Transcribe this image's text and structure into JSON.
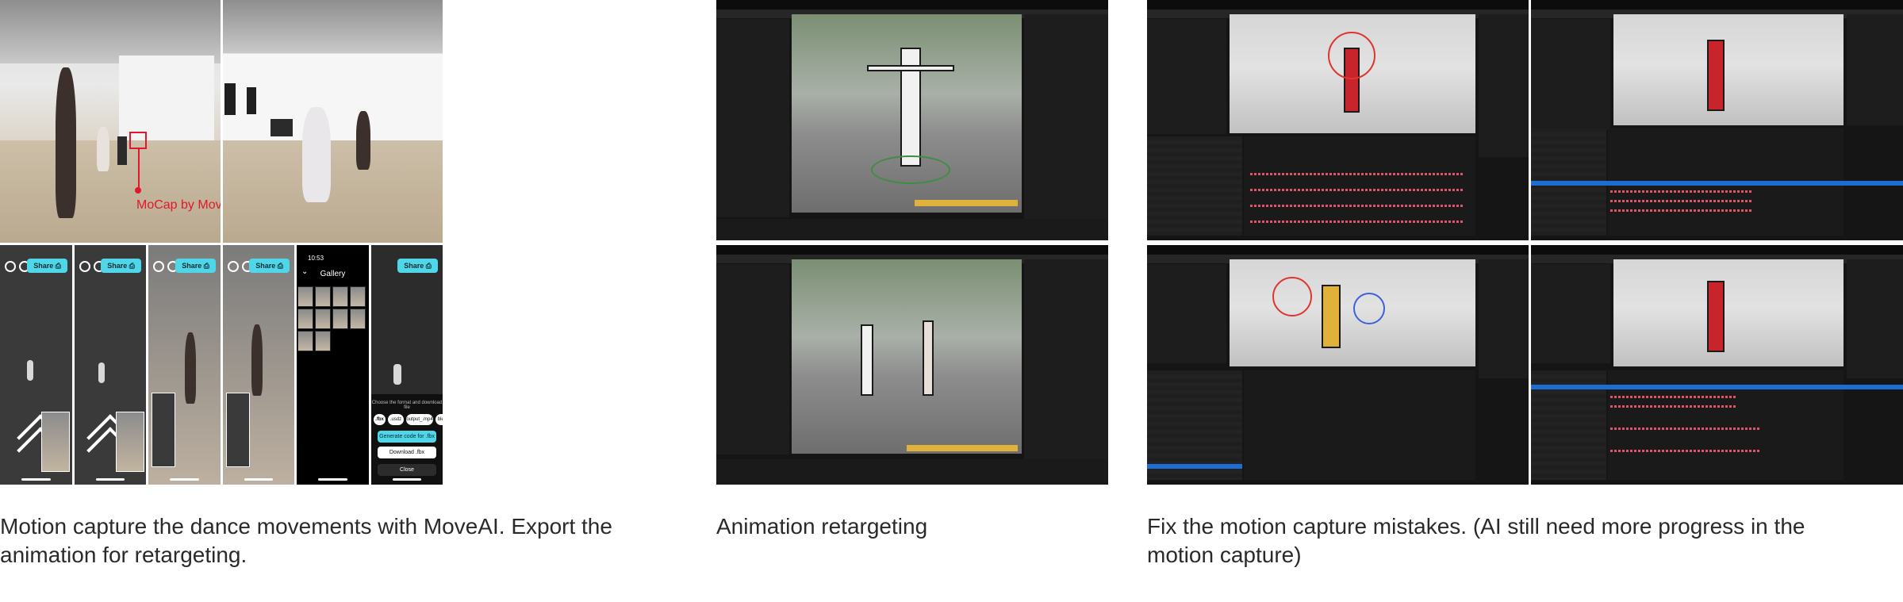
{
  "sections": [
    {
      "caption": "Motion capture the dance movements with MoveAI. Export the animation for retargeting."
    },
    {
      "caption": "Animation retargeting"
    },
    {
      "caption": "Fix the motion capture mistakes. (AI still need more progress in the motion capture)"
    }
  ],
  "photo_annotation": {
    "label": "MoCap by MoveAI",
    "color": "#e0182b"
  },
  "phone": {
    "share_label": "Share ⎙",
    "time": "10:53",
    "gallery_title": "Gallery",
    "export_prompt": "Choose the format and download file",
    "formats": [
      ".fbx",
      ".usdz",
      "output_.mp4",
      "blend"
    ],
    "generate_label": "Generate code for .fbx",
    "download_label": "Download .fbx",
    "close_label": "Close",
    "accent": "#4fd6e8"
  },
  "icons": [
    "chevron-down-icon",
    "expand-icon",
    "share-icon",
    "chevron-up-icon"
  ]
}
